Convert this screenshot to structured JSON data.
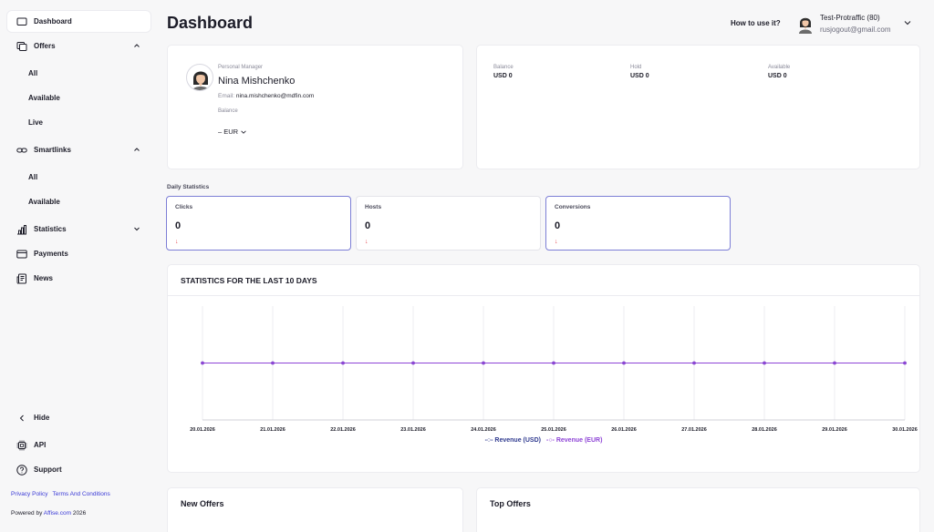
{
  "sidebar": {
    "dashboard": "Dashboard",
    "offers": "Offers",
    "offers_sub": [
      "All",
      "Available",
      "Live"
    ],
    "smartlinks": "Smartlinks",
    "smartlinks_sub": [
      "All",
      "Available"
    ],
    "statistics": "Statistics",
    "payments": "Payments",
    "news": "News",
    "hide": "Hide",
    "api": "API",
    "support": "Support",
    "privacy": "Privacy Policy",
    "terms": "Terms And Conditions",
    "powered_prefix": "Powered by",
    "powered_link": "Affise.com",
    "powered_year": "2026"
  },
  "header": {
    "title": "Dashboard",
    "how_to": "How to use it?",
    "user_name": "Test-Protraffic (80)",
    "user_email": "rusjogout@gmail.com"
  },
  "manager": {
    "role": "Personal Manager",
    "name": "Nina Mishchenko",
    "email_label": "Email:",
    "email": "nina.mishchenko@mdfin.com",
    "balance_label": "Balance",
    "balance_value": "– EUR"
  },
  "balance": {
    "items": [
      {
        "label": "Balance",
        "value": "USD 0"
      },
      {
        "label": "Hold",
        "value": "USD 0"
      },
      {
        "label": "Available",
        "value": "USD 0"
      }
    ]
  },
  "daily": {
    "title": "Daily Statistics",
    "cards": [
      {
        "label": "Clicks",
        "value": "0",
        "arrow": "↓"
      },
      {
        "label": "Hosts",
        "value": "0",
        "arrow": "↓"
      },
      {
        "label": "Conversions",
        "value": "0",
        "arrow": "↓"
      }
    ]
  },
  "chart_data": {
    "type": "line",
    "title": "STATISTICS FOR THE LAST 10 DAYS",
    "categories": [
      "20.01.2026",
      "21.01.2026",
      "22.01.2026",
      "23.01.2026",
      "24.01.2026",
      "25.01.2026",
      "26.01.2026",
      "27.01.2026",
      "28.01.2026",
      "29.01.2026",
      "30.01.2026"
    ],
    "series": [
      {
        "name": "Revenue (USD)",
        "values": [
          0,
          0,
          0,
          0,
          0,
          0,
          0,
          0,
          0,
          0,
          0
        ],
        "color": "#2f3a8f"
      },
      {
        "name": "Revenue (EUR)",
        "values": [
          0,
          0,
          0,
          0,
          0,
          0,
          0,
          0,
          0,
          0,
          0
        ],
        "color": "#8e44d6"
      }
    ],
    "grid": true,
    "legend": "bottom"
  },
  "bottom": {
    "new_offers": "New Offers",
    "top_offers": "Top Offers"
  }
}
